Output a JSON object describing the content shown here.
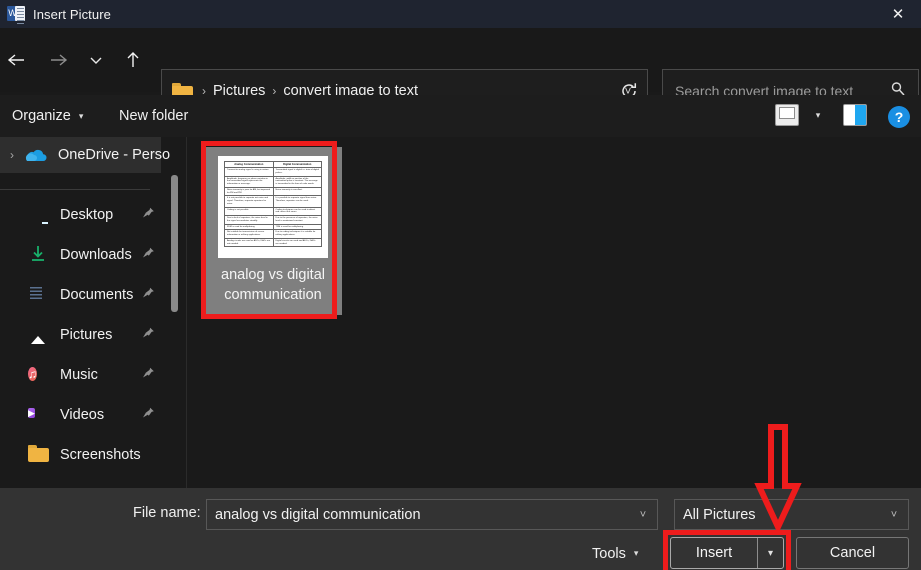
{
  "window": {
    "title": "Insert Picture",
    "app_icon": "word-document-icon",
    "close_label": "✕"
  },
  "nav": {
    "back": "←",
    "forward": "→",
    "recent": "˅",
    "up": "↑"
  },
  "address": {
    "folder_icon": "folder-icon",
    "crumbs": [
      "Pictures",
      "convert image to text"
    ],
    "separator": "›",
    "chevron": "˅",
    "refresh_icon": "refresh-icon"
  },
  "search": {
    "placeholder": "Search convert image to text",
    "icon": "search-icon"
  },
  "toolbar": {
    "organize": "Organize",
    "new_folder": "New folder",
    "caret": "▾",
    "view_icon": "view-options-icon",
    "preview_pane_icon": "preview-pane-icon",
    "help": "?"
  },
  "sidebar": {
    "onedrive": {
      "label": "OneDrive - Perso",
      "icon": "onedrive-cloud-icon",
      "chevron": "›"
    },
    "items": [
      {
        "label": "Desktop",
        "icon": "desktop-icon",
        "pinned": true
      },
      {
        "label": "Downloads",
        "icon": "download-icon",
        "pinned": true
      },
      {
        "label": "Documents",
        "icon": "documents-icon",
        "pinned": true
      },
      {
        "label": "Pictures",
        "icon": "pictures-icon",
        "pinned": true
      },
      {
        "label": "Music",
        "icon": "music-icon",
        "pinned": true
      },
      {
        "label": "Videos",
        "icon": "videos-icon",
        "pinned": true
      },
      {
        "label": "Screenshots",
        "icon": "folder-icon",
        "pinned": false
      }
    ],
    "pin_glyph": "📌"
  },
  "files": [
    {
      "name_line1": "analog vs digital",
      "name_line2": "communication",
      "selected": true,
      "thumbnail": {
        "headers": [
          "Analog Communication",
          "Digital Communication"
        ],
        "rows": [
          [
            "Transmit to analog signal is using in nature.",
            "Transmitted signal is digital i.e. train of digital pulses."
          ],
          [
            "Amplitude, frequency or phase variation in the transmitted signal represents the information or message.",
            "Amplitude, width or position of the transmitted pulse is constant. The message is transmitted in the form of code words."
          ],
          [
            "Noise immunity is poor for AM, but improved for FM and PM.",
            "Noise immunity is excellent."
          ],
          [
            "It is not possible to separate out noise and signal. Therefore, separate repeaters for noise.",
            "It is possible to separate signal from noise. Therefore, repeaters can be used."
          ],
          [
            "Coding is not possible.",
            "Coding techniques can be used to detect and correct the errors."
          ],
          [
            "Due to lack of repeaters, the noise level in the signal accumulates steadily.",
            "Due to the presence of repeaters, the noise level is maintained constant."
          ],
          [
            "FDM is used for multiplexing.",
            "TDM is used for multiplexing."
          ],
          [
            "Not suitable for transmission of secure information or military applications.",
            "Due to coding techniques it is suitable for military applications."
          ],
          [
            "Analog circuits are used as ADCs, DACs are not needed.",
            "Digital circuits are used and ADCs, DACs are needed."
          ]
        ]
      }
    }
  ],
  "bottom": {
    "filename_label": "File name:",
    "filename_value": "analog vs digital communication",
    "filter_value": "All Pictures",
    "tools": "Tools",
    "insert": "Insert",
    "cancel": "Cancel",
    "caret": "▾",
    "chevron": "˅"
  },
  "annotations": {
    "color": "#ee1c1c",
    "arrow": "down-arrow-annotation",
    "boxes": [
      "selected-file-highlight",
      "insert-button-highlight"
    ]
  }
}
